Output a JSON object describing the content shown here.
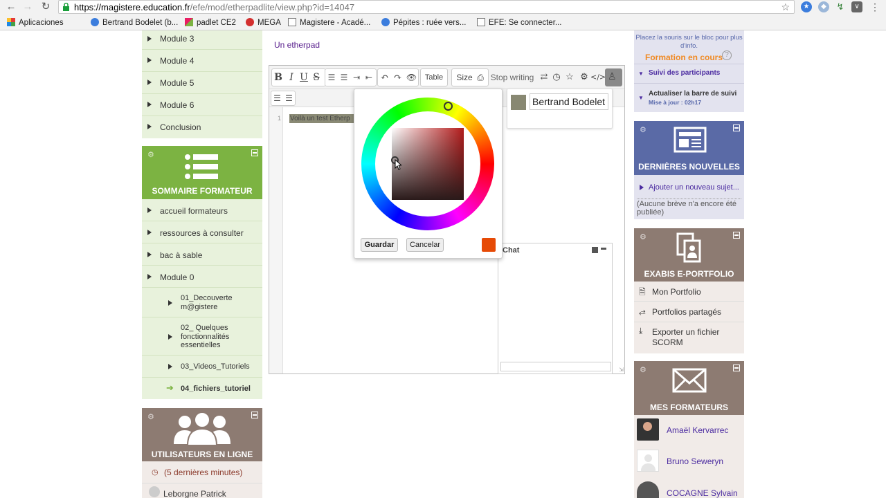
{
  "browser": {
    "url_domain": "https://magistere.education.fr",
    "url_path": "/efe/mod/etherpadlite/view.php?id=14047",
    "bookmarks": [
      "Aplicaciones",
      "Bertrand Bodelet (b...",
      "padlet CE2",
      "MEGA",
      "Magistere - Acadé...",
      "Pépites : ruée vers...",
      "EFE: Se connecter..."
    ]
  },
  "left": {
    "modules": [
      "Module 3",
      "Module 4",
      "Module 5",
      "Module 6",
      "Conclusion"
    ],
    "sommaire_title": "SOMMAIRE FORMATEUR",
    "sommaire_items": [
      "accueil formateurs",
      "ressources à consulter",
      "bac à sable",
      "Module 0"
    ],
    "sub_items": [
      "01_Decouverte m@gistere",
      "02_ Quelques fonctionnalités essentielles",
      "03_Videos_Tutoriels",
      "04_fichiers_tutoriel"
    ],
    "online_title": "UTILISATEURS EN LIGNE",
    "online_period": "(5 dernières minutes)",
    "online_user": "Leborgne Patrick"
  },
  "main": {
    "link": "Un etherpad",
    "toolbar": {
      "bold": "B",
      "italic": "I",
      "underline": "U",
      "strike": "S",
      "table": "Table",
      "size": "Size",
      "stop_writing": "Stop writing"
    },
    "line_number": "1",
    "pad_text": "Voilà un test Etherp",
    "user_name": "Bertrand Bodelet",
    "chat_title": "Chat"
  },
  "picker": {
    "save": "Guardar",
    "cancel": "Cancelar",
    "selected_color": "#e64a06"
  },
  "right": {
    "help_text": "Placez la souris sur le bloc pour plus d'info.",
    "formation_title": "Formation en cours",
    "suivi": "Suivi des participants",
    "actualiser": "Actualiser la barre de suivi",
    "maj": "Mise à jour : 02h17",
    "news_title": "DERNIÈRES NOUVELLES",
    "news_link": "Ajouter un nouveau sujet...",
    "news_empty": "(Aucune brève n'a encore été publiée)",
    "portfolio_title": "EXABIS E-PORTFOLIO",
    "portfolio_items": [
      "Mon Portfolio",
      "Portfolios partagés",
      "Exporter un fichier SCORM"
    ],
    "formateurs_title": "MES FORMATEURS",
    "formateurs": [
      "Amaël Kervarrec",
      "Bruno Seweryn",
      "COCAGNE Sylvain"
    ]
  }
}
